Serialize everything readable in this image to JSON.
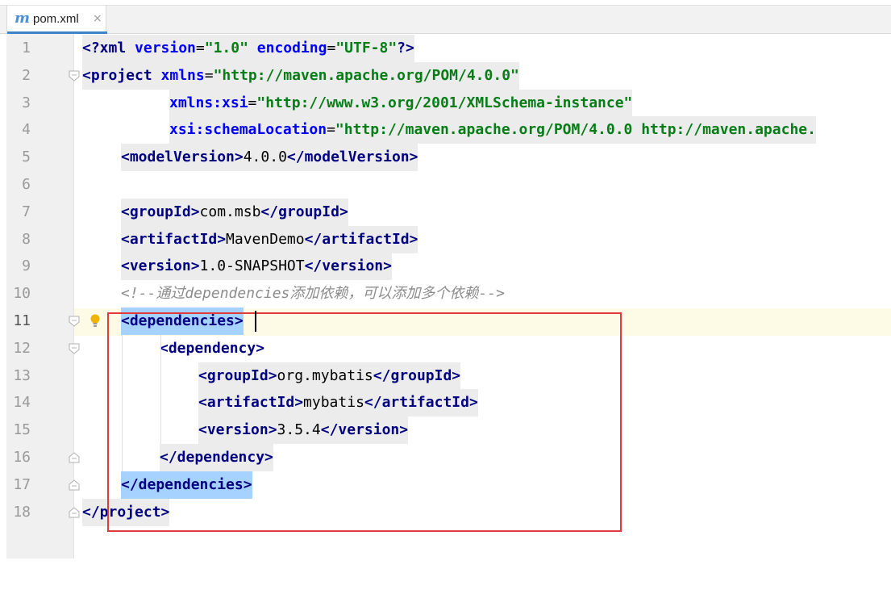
{
  "tab": {
    "icon": "maven-m-icon",
    "icon_glyph": "m",
    "label": "pom.xml",
    "close": "×"
  },
  "lines": [
    {
      "num": "1",
      "indent": 0,
      "parts": [
        [
          "tag",
          "<?xml "
        ],
        [
          "an",
          "version"
        ],
        [
          "txt",
          "="
        ],
        [
          "av",
          "\"1.0\""
        ],
        [
          "txt",
          " "
        ],
        [
          "an",
          "encoding"
        ],
        [
          "txt",
          "="
        ],
        [
          "av",
          "\"UTF-8\""
        ],
        [
          "tag",
          "?>"
        ]
      ]
    },
    {
      "num": "2",
      "indent": 0,
      "parts": [
        [
          "tag",
          "<project "
        ],
        [
          "an",
          "xmlns"
        ],
        [
          "txt",
          "="
        ],
        [
          "av",
          "\"http://maven.apache.org/POM/4.0.0\""
        ]
      ]
    },
    {
      "num": "3",
      "indent": 9,
      "parts": [
        [
          "an",
          "xmlns:xsi"
        ],
        [
          "txt",
          "="
        ],
        [
          "av",
          "\"http://www.w3.org/2001/XMLSchema-instance\""
        ]
      ]
    },
    {
      "num": "4",
      "indent": 9,
      "parts": [
        [
          "an",
          "xsi:schemaLocation"
        ],
        [
          "txt",
          "="
        ],
        [
          "av",
          "\"http://maven.apache.org/POM/4.0.0 http://maven.apache."
        ]
      ]
    },
    {
      "num": "5",
      "indent": 4,
      "parts": [
        [
          "tag",
          "<modelVersion>"
        ],
        [
          "txt",
          "4.0.0"
        ],
        [
          "tag",
          "</modelVersion>"
        ]
      ]
    },
    {
      "num": "6",
      "indent": 0,
      "parts": []
    },
    {
      "num": "7",
      "indent": 4,
      "parts": [
        [
          "tag",
          "<groupId>"
        ],
        [
          "txt",
          "com.msb"
        ],
        [
          "tag",
          "</groupId>"
        ]
      ]
    },
    {
      "num": "8",
      "indent": 4,
      "parts": [
        [
          "tag",
          "<artifactId>"
        ],
        [
          "txt",
          "MavenDemo"
        ],
        [
          "tag",
          "</artifactId>"
        ]
      ]
    },
    {
      "num": "9",
      "indent": 4,
      "parts": [
        [
          "tag",
          "<version>"
        ],
        [
          "txt",
          "1.0-SNAPSHOT"
        ],
        [
          "tag",
          "</version>"
        ]
      ]
    },
    {
      "num": "10",
      "indent": 4,
      "parts": [
        [
          "cm",
          "<!--通过dependencies添加依赖，可以添加多个依赖-->"
        ]
      ]
    },
    {
      "num": "11",
      "indent": 4,
      "parts": [
        [
          "tag",
          "<dependencies>"
        ]
      ]
    },
    {
      "num": "12",
      "indent": 8,
      "parts": [
        [
          "tag",
          "<dependency>"
        ]
      ]
    },
    {
      "num": "13",
      "indent": 12,
      "parts": [
        [
          "tag",
          "<groupId>"
        ],
        [
          "txt",
          "org.mybatis"
        ],
        [
          "tag",
          "</groupId>"
        ]
      ]
    },
    {
      "num": "14",
      "indent": 12,
      "parts": [
        [
          "tag",
          "<artifactId>"
        ],
        [
          "txt",
          "mybatis"
        ],
        [
          "tag",
          "</artifactId>"
        ]
      ]
    },
    {
      "num": "15",
      "indent": 12,
      "parts": [
        [
          "tag",
          "<version>"
        ],
        [
          "txt",
          "3.5.4"
        ],
        [
          "tag",
          "</version>"
        ]
      ]
    },
    {
      "num": "16",
      "indent": 8,
      "parts": [
        [
          "tag",
          "</dependency>"
        ]
      ]
    },
    {
      "num": "17",
      "indent": 4,
      "parts": [
        [
          "tag",
          "</dependencies>"
        ]
      ]
    },
    {
      "num": "18",
      "indent": 0,
      "parts": [
        [
          "tag",
          "</project>"
        ]
      ]
    }
  ],
  "current_line": "11",
  "colors": {
    "tag": "#000080",
    "attr_name": "#0000ff",
    "attr_value": "#067d17",
    "comment": "#8c8c8c",
    "highlight_box": "#e3393b"
  }
}
